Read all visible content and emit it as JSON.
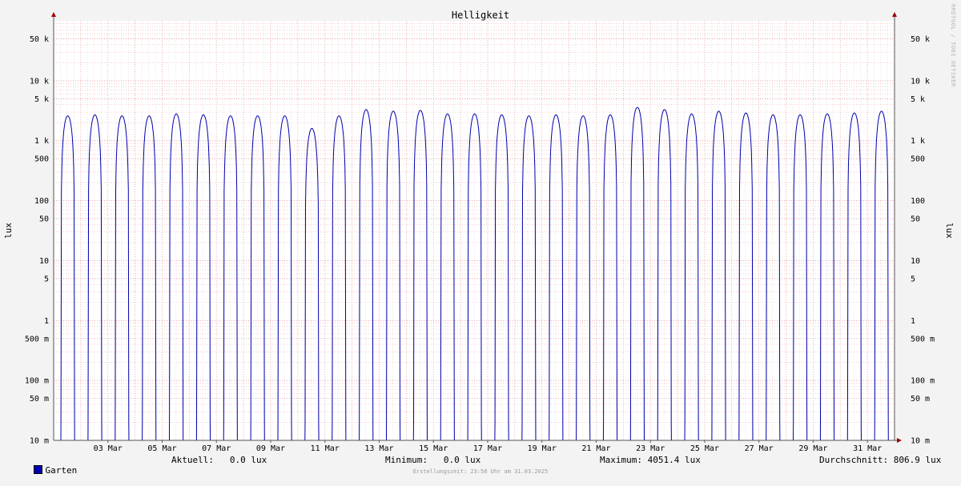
{
  "chart_data": {
    "type": "line",
    "title": "Helligkeit",
    "ylabel": "lux",
    "yscale": "log",
    "ylim": [
      0.01,
      100000
    ],
    "y_ticks": [
      {
        "v": 0.01,
        "label": "10 m"
      },
      {
        "v": 0.05,
        "label": "50 m"
      },
      {
        "v": 0.1,
        "label": "100 m"
      },
      {
        "v": 0.5,
        "label": "500 m"
      },
      {
        "v": 1,
        "label": "1"
      },
      {
        "v": 5,
        "label": "5"
      },
      {
        "v": 10,
        "label": "10"
      },
      {
        "v": 50,
        "label": "50"
      },
      {
        "v": 100,
        "label": "100"
      },
      {
        "v": 500,
        "label": "500"
      },
      {
        "v": 1000,
        "label": "1 k"
      },
      {
        "v": 5000,
        "label": "5 k"
      },
      {
        "v": 10000,
        "label": "10 k"
      },
      {
        "v": 50000,
        "label": "50 k"
      }
    ],
    "xlim_days": [
      1,
      32
    ],
    "x_ticks": [
      {
        "day": 3,
        "label": "03 Mar"
      },
      {
        "day": 5,
        "label": "05 Mar"
      },
      {
        "day": 7,
        "label": "07 Mar"
      },
      {
        "day": 9,
        "label": "09 Mar"
      },
      {
        "day": 11,
        "label": "11 Mar"
      },
      {
        "day": 13,
        "label": "13 Mar"
      },
      {
        "day": 15,
        "label": "15 Mar"
      },
      {
        "day": 17,
        "label": "17 Mar"
      },
      {
        "day": 19,
        "label": "19 Mar"
      },
      {
        "day": 21,
        "label": "21 Mar"
      },
      {
        "day": 23,
        "label": "23 Mar"
      },
      {
        "day": 25,
        "label": "25 Mar"
      },
      {
        "day": 27,
        "label": "27 Mar"
      },
      {
        "day": 29,
        "label": "29 Mar"
      },
      {
        "day": 31,
        "label": "31 Mar"
      }
    ],
    "grid": true,
    "series": [
      {
        "name": "Garten",
        "color": "#0000b0",
        "daily_peak_lux": [
          2600,
          2700,
          2600,
          2600,
          2800,
          2700,
          2600,
          2600,
          2600,
          1600,
          2600,
          3300,
          3100,
          3200,
          2800,
          2800,
          2700,
          2600,
          2700,
          2600,
          2700,
          3600,
          3300,
          2800,
          3100,
          2900,
          2700,
          2700,
          2800,
          2900,
          3100
        ]
      }
    ]
  },
  "legend": {
    "series_name": "Garten",
    "current": "Aktuell:   0.0 lux",
    "minimum": "Minimum:   0.0 lux",
    "maximum": "Maximum: 4051.4 lux",
    "average": "Durchschnitt: 806.9 lux"
  },
  "footer": "Erstellungszeit: 23:58 Uhr am 31.03.2025",
  "watermark": "RRDTOOL / TOBI OETIKER"
}
